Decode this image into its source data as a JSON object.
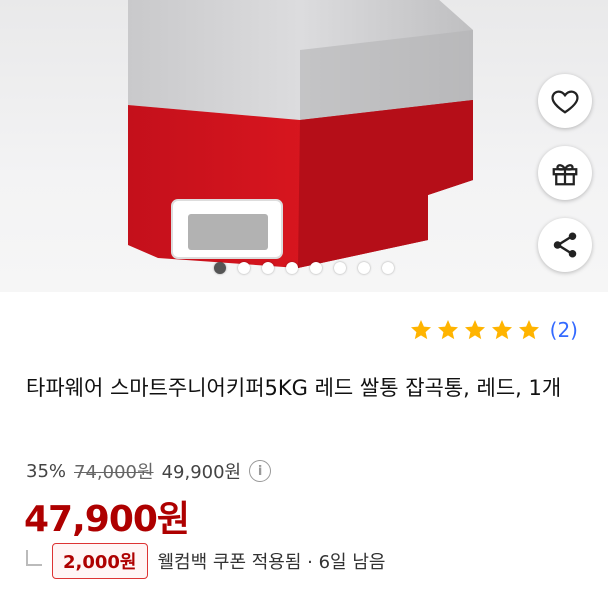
{
  "product": {
    "title": "타파웨어 스마트주니어키퍼5KG 레드 쌀통 잡곡통, 레드, 1개",
    "rating_stars": 5,
    "review_count": "(2)",
    "discount_rate": "35%",
    "original_price": "74,000원",
    "sale_price": "49,900원",
    "final_price": "47,900원"
  },
  "coupon": {
    "amount": "2,000원",
    "text": "웰컴백 쿠폰 적용됨 · 6일 남음"
  },
  "gallery": {
    "image_count": 8,
    "active_index": 0
  },
  "actions": {
    "wishlist_icon": "heart-icon",
    "gift_icon": "gift-icon",
    "share_icon": "share-icon"
  },
  "colors": {
    "price_red": "#ae0000",
    "star_yellow": "#ffb400",
    "link_blue": "#346aff",
    "product_red": "#d3121e"
  }
}
